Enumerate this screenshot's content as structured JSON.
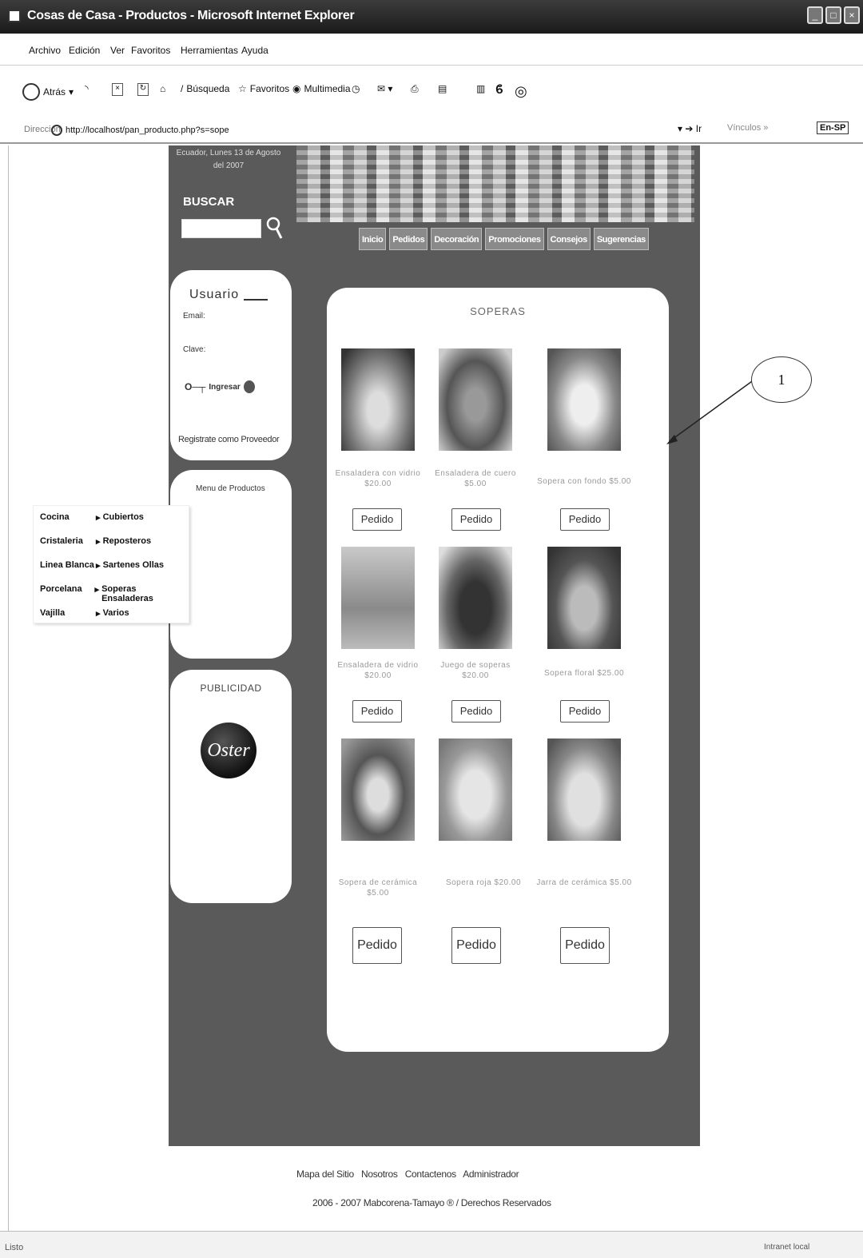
{
  "window": {
    "title": "Cosas de Casa - Productos - Microsoft Internet Explorer"
  },
  "menubar": {
    "items": [
      "Archivo",
      "Edición",
      "Ver",
      "Favoritos",
      "Herramientas",
      "Ayuda"
    ]
  },
  "toolbar": {
    "back_label": "Atrás",
    "search_label": "Búsqueda",
    "favorites_label": "Favoritos",
    "multimedia_label": "Multimedia"
  },
  "addressbar": {
    "label": "Dirección",
    "url": "http://localhost/pan_producto.php?s=sope",
    "go_label": "Ir",
    "links_label": "Vínculos",
    "language": "En-SP"
  },
  "site": {
    "date": "Ecuador, Lunes 13 de Agosto del 2007",
    "search_label": "BUSCAR",
    "nav": [
      "Inicio",
      "Pedidos",
      "Decoración",
      "Promociones",
      "Consejos",
      "Sugerencias"
    ],
    "user": {
      "title": "Usuario",
      "email_label": "Email:",
      "password_label": "Clave:",
      "login_label": "Ingresar",
      "register_label": "Registrate como Proveedor"
    },
    "menu": {
      "title": "Menu de Productos",
      "rows": [
        {
          "left": "Cocina",
          "right": "Cubiertos"
        },
        {
          "left": "Cristaleria",
          "right": "Reposteros"
        },
        {
          "left": "Linea Blanca",
          "right": "Sartenes Ollas"
        },
        {
          "left": "Porcelana",
          "right": "Soperas Ensaladeras"
        },
        {
          "left": "Vajilla",
          "right": "Varios"
        }
      ]
    },
    "ads": {
      "title": "PUBLICIDAD",
      "brand": "Oster"
    },
    "products": {
      "title": "SOPERAS",
      "button_label": "Pedido",
      "items": [
        {
          "name": "Ensaladera con vidrio $20.00"
        },
        {
          "name": "Ensaladera de cuero $5.00"
        },
        {
          "name": "Sopera con fondo $5.00"
        },
        {
          "name": "Ensaladera de vidrio $20.00"
        },
        {
          "name": "Juego de soperas $20.00"
        },
        {
          "name": "Sopera floral $25.00"
        },
        {
          "name": "Sopera de cerámica $5.00"
        },
        {
          "name": "Sopera roja $20.00"
        },
        {
          "name": "Jarra de cerámica $5.00"
        }
      ]
    },
    "footer": {
      "links": [
        "Mapa del Sitio",
        "Nosotros",
        "Contactenos",
        "Administrador"
      ],
      "copyright": "2006 - 2007 Mabcorena-Tamayo ® / Derechos Reservados"
    }
  },
  "annotation": {
    "number": "1"
  },
  "statusbar": {
    "left": "Listo",
    "right": "Intranet local"
  }
}
